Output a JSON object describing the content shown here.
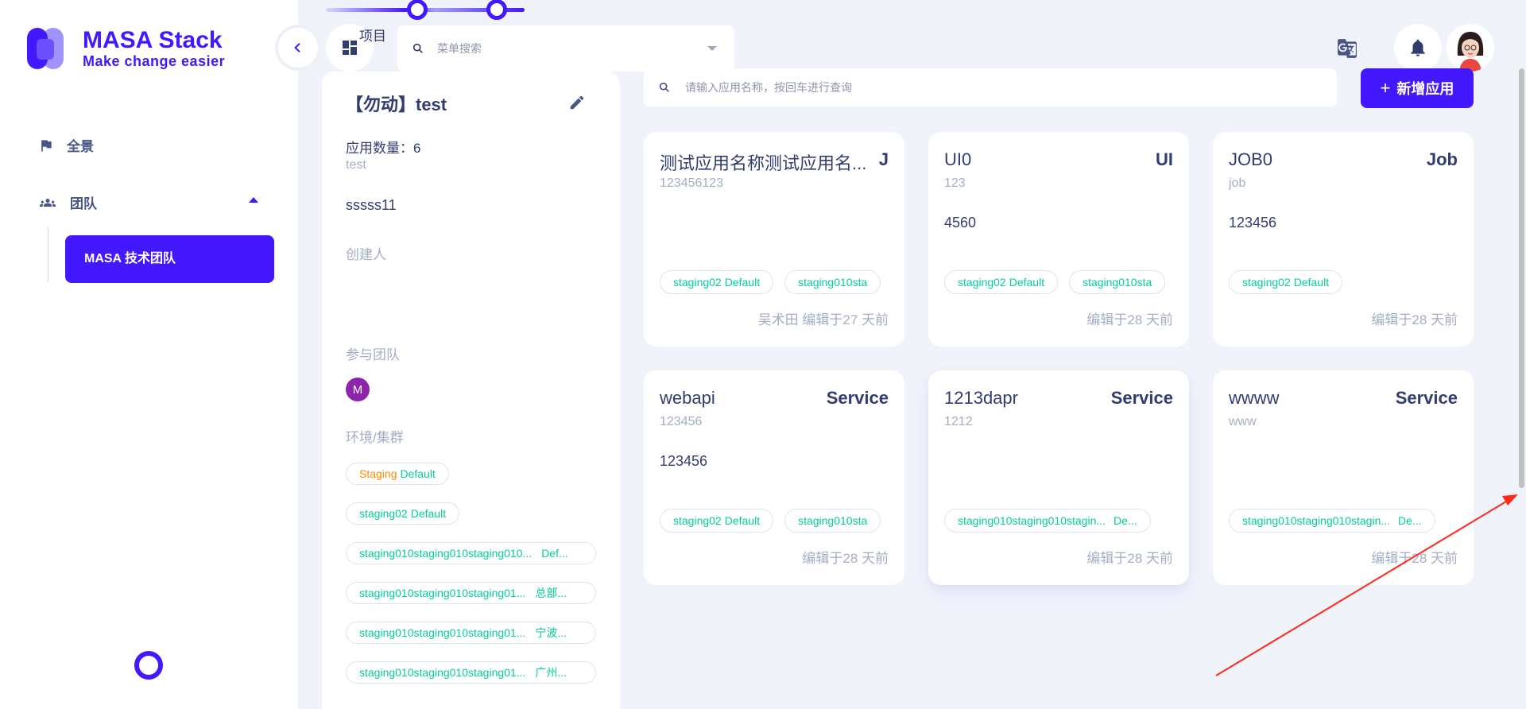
{
  "brand": {
    "title": "MASA Stack",
    "tagline": "Make change easier"
  },
  "sidebar": {
    "items": [
      {
        "label": "全景",
        "icon": "flag-icon"
      },
      {
        "label": "团队",
        "icon": "team-icon"
      }
    ],
    "sub_items": [
      {
        "label": "MASA 技术团队"
      }
    ]
  },
  "topbar": {
    "project_label": "项目",
    "menu_search_placeholder": "菜单搜索"
  },
  "project": {
    "title": "【勿动】test",
    "app_count_label": "应用数量：6",
    "identity": "test",
    "description": "sssss11",
    "creator_label": "创建人",
    "teams_label": "参与团队",
    "member_initial": "M",
    "env_label": "环境/集群",
    "envs": [
      {
        "name": "Staging",
        "cluster": "Default"
      },
      {
        "name": "staging02",
        "cluster": "Default"
      },
      {
        "name": "staging010staging010staging010...",
        "cluster": "Def..."
      },
      {
        "name": "staging010staging010staging01...",
        "cluster": "总部..."
      },
      {
        "name": "staging010staging010staging01...",
        "cluster": "宁波..."
      },
      {
        "name": "staging010staging010staging01...",
        "cluster": "广州..."
      }
    ]
  },
  "apps": {
    "search_placeholder": "请输入应用名称，按回车进行查询",
    "add_label": "新增应用",
    "cards": [
      {
        "name": "测试应用名称测试应用名...",
        "type": "J",
        "id": "123456123",
        "desc": "",
        "chips": [
          {
            "env": "staging02",
            "cluster": "Default"
          },
          {
            "env": "staging010sta",
            "cluster": ""
          }
        ],
        "footer": "吴术田 编辑于27 天前"
      },
      {
        "name": "UI0",
        "type": "UI",
        "id": "123",
        "desc": "4560",
        "chips": [
          {
            "env": "staging02",
            "cluster": "Default"
          },
          {
            "env": "staging010sta",
            "cluster": ""
          }
        ],
        "footer": "编辑于28 天前"
      },
      {
        "name": "JOB0",
        "type": "Job",
        "id": "job",
        "desc": "123456",
        "chips": [
          {
            "env": "staging02",
            "cluster": "Default"
          }
        ],
        "footer": "编辑于28 天前"
      },
      {
        "name": "webapi",
        "type": "Service",
        "id": "123456",
        "desc": "123456",
        "chips": [
          {
            "env": "staging02",
            "cluster": "Default"
          },
          {
            "env": "staging010sta",
            "cluster": ""
          }
        ],
        "footer": "编辑于28 天前"
      },
      {
        "name": "1213dapr",
        "type": "Service",
        "id": "1212",
        "desc": "",
        "chips": [
          {
            "env": "staging010staging010stagin...",
            "cluster": "De..."
          }
        ],
        "footer": "编辑于28 天前"
      },
      {
        "name": "wwww",
        "type": "Service",
        "id": "www",
        "desc": "",
        "chips": [
          {
            "env": "staging010staging010stagin...",
            "cluster": "De..."
          }
        ],
        "footer": "编辑于28 天前"
      }
    ]
  },
  "colors": {
    "primary": "#4318ff",
    "success": "#05cd99",
    "warning": "#ff8a00",
    "annotation": "#ff2a1a"
  }
}
